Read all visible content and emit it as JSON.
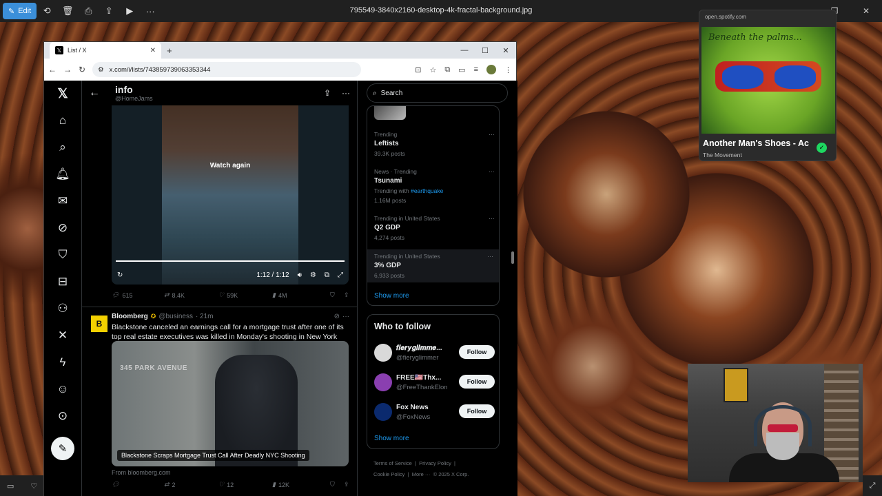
{
  "viewer": {
    "edit_label": "Edit",
    "filename": "795549-3840x2160-desktop-4k-fractal-background.jpg",
    "toolbar_icons": [
      "rotate-icon",
      "delete-icon",
      "print-icon",
      "share-icon",
      "slideshow-icon",
      "more-icon"
    ]
  },
  "browser": {
    "tab_title": "List / X",
    "url": "x.com/i/lists/743859739063353344"
  },
  "list_header": {
    "title": "info",
    "handle": "@HomeJams"
  },
  "video": {
    "overlay_text": "Watch again",
    "time": "1:12 / 1:12",
    "progress": 1.0
  },
  "video_tweet_stats": {
    "replies": "615",
    "reposts": "8.4K",
    "likes": "59K",
    "views": "4M"
  },
  "tweet": {
    "avatar_letter": "B",
    "name": "Bloomberg",
    "handle": "@business",
    "time": "· 21m",
    "text": "Blackstone canceled an earnings call for a mortgage trust after one of its top real estate executives was killed in Monday's shooting in New York City.",
    "image_street_sign": "345 PARK AVENUE",
    "image_caption": "Blackstone Scraps Mortgage Trust Call After Deadly NYC Shooting",
    "source": "From bloomberg.com",
    "replies": "",
    "reposts": "2",
    "likes": "12",
    "views": "12K"
  },
  "search": {
    "placeholder": "Search"
  },
  "trends": [
    {
      "context": "Trending",
      "name": "Leftists",
      "extra": "",
      "extra_tag": "",
      "posts": "39.3K posts"
    },
    {
      "context": "News · Trending",
      "name": "Tsunami",
      "extra": "Trending with",
      "extra_tag": "#earthquake",
      "posts": "1.16M posts"
    },
    {
      "context": "Trending in United States",
      "name": "Q2 GDP",
      "extra": "",
      "extra_tag": "",
      "posts": "4,274 posts"
    },
    {
      "context": "Trending in United States",
      "name": "3% GDP",
      "extra": "",
      "extra_tag": "",
      "posts": "6,933 posts"
    }
  ],
  "show_more": "Show more",
  "who_to_follow": {
    "title": "Who to follow",
    "users": [
      {
        "name": "𝒇𝒊𝒆𝒓𝒚𝒈𝒍𝒊𝒎𝒎𝒆...",
        "handle": "@fieryglimmer",
        "button": "Follow",
        "color": "#d9d9d9"
      },
      {
        "name": "FREE🇺🇸Thx...",
        "handle": "@FreeThankElon",
        "button": "Follow",
        "color": "#8a3fb0"
      },
      {
        "name": "Fox News",
        "handle": "@FoxNews",
        "button": "Follow",
        "color": "#0b2a6e"
      }
    ],
    "show_more": "Show more"
  },
  "footer": {
    "line1": [
      "Terms of Service",
      "|",
      "Privacy Policy",
      "|"
    ],
    "line2": [
      "Cookie Policy",
      "|",
      "More ···",
      "© 2025 X Corp."
    ]
  },
  "spotify": {
    "url": "open.spotify.com",
    "album_art_text": "Beneath the palms...",
    "track": "Another Man's Shoes - Ac",
    "artist": "The Movement"
  },
  "colors": {
    "x_blue": "#1d9bf0",
    "edit_blue": "#3b8fd9",
    "spotify_green": "#1ed760",
    "bloomberg_gold": "#e7b800"
  }
}
